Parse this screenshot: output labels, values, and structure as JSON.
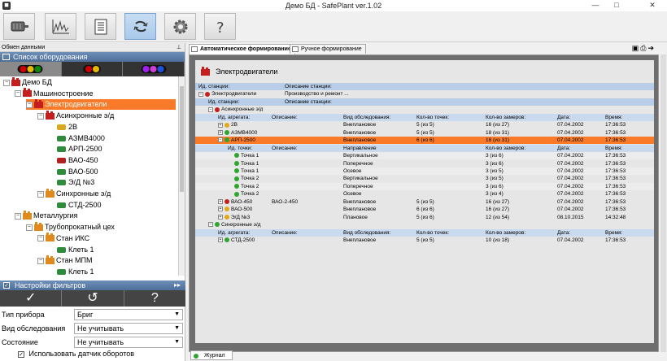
{
  "window": {
    "title": "Демо БД - SafePlant ver.1.02",
    "minimize": "—",
    "maximize": "□",
    "close": "✕"
  },
  "toolbar": {
    "buttons": [
      "motor",
      "spectrum",
      "report",
      "sync",
      "settings",
      "help"
    ]
  },
  "left": {
    "panel_title": "Обмен данными",
    "equipment_header": "Список оборудования",
    "filter_colors": [
      [
        "#d00000",
        "#e6b800",
        "#0a8a0a"
      ],
      [
        "#d00000",
        "#e6b800"
      ],
      [
        "#a020f0",
        "#d040d0",
        "#2050e0"
      ]
    ],
    "tree": [
      {
        "label": "Демо БД",
        "level": 0,
        "icon": "folder-red",
        "expand": "−"
      },
      {
        "label": "Машиностроение",
        "level": 1,
        "icon": "folder-red",
        "expand": "−"
      },
      {
        "label": "Электродвигатели",
        "level": 2,
        "icon": "folder-red",
        "expand": "−",
        "selected": true
      },
      {
        "label": "Асинхронные э/д",
        "level": 3,
        "icon": "folder-red",
        "expand": "−"
      },
      {
        "label": "2В",
        "level": 4,
        "icon": "motor-yellow"
      },
      {
        "label": "АЗМВ4000",
        "level": 4,
        "icon": "motor-green"
      },
      {
        "label": "АРП-2500",
        "level": 4,
        "icon": "motor-green"
      },
      {
        "label": "ВАО-450",
        "level": 4,
        "icon": "motor-red"
      },
      {
        "label": "ВАО-500",
        "level": 4,
        "icon": "motor-green"
      },
      {
        "label": "Э/Д №3",
        "level": 4,
        "icon": "motor-green"
      },
      {
        "label": "Синхронные э/д",
        "level": 3,
        "icon": "folder-orange",
        "expand": "−"
      },
      {
        "label": "СТД-2500",
        "level": 4,
        "icon": "motor-green"
      },
      {
        "label": "Металлургия",
        "level": 1,
        "icon": "folder-orange",
        "expand": "−"
      },
      {
        "label": "Трубопрокатный цех",
        "level": 2,
        "icon": "folder-orange",
        "expand": "−"
      },
      {
        "label": "Стан ИКС",
        "level": 3,
        "icon": "folder-orange",
        "expand": "−"
      },
      {
        "label": "Клеть 1",
        "level": 4,
        "icon": "motor-green"
      },
      {
        "label": "Стан МПМ",
        "level": 3,
        "icon": "folder-orange",
        "expand": "−"
      },
      {
        "label": "Клеть 1",
        "level": 4,
        "icon": "motor-green"
      }
    ],
    "filters_header": "Настройки фильтров",
    "action_labels": [
      "✓",
      "↺",
      "?"
    ],
    "filters": [
      {
        "label": "Тип прибора",
        "value": "Бриг"
      },
      {
        "label": "Вид обследования",
        "value": "Не учитывать"
      },
      {
        "label": "Состояние",
        "value": "Не учитывать"
      }
    ],
    "checkbox_label": "Использовать датчик оборотов",
    "checkbox_mark": "✓"
  },
  "tabs": [
    {
      "label": "Автоматическое формирование",
      "active": true
    },
    {
      "label": "Ручное формирование",
      "active": false
    }
  ],
  "doc_title": "Электродвигатели",
  "report_rows": [
    {
      "type": "hdr",
      "indent": 0,
      "cells": [
        "Ид. станции:",
        "Описание станции:"
      ]
    },
    {
      "type": "plain",
      "indent": 0,
      "pm": "−",
      "dot": "r",
      "cells": [
        "Электродвигатели",
        "Производство и ремонт ..."
      ]
    },
    {
      "type": "hdr",
      "indent": 1,
      "cells": [
        "Ид. станции:",
        "Описание станции:"
      ]
    },
    {
      "type": "plain",
      "indent": 1,
      "pm": "−",
      "dot": "r",
      "cells": [
        "Асинхронные э/д"
      ]
    },
    {
      "type": "hdr2",
      "indent": 2,
      "cells": [
        "Ид. агрегата:",
        "Описание:",
        "Вид обследования:",
        "Кол-во точек:",
        "Кол-во замеров:",
        "Дата:",
        "Время:"
      ]
    },
    {
      "type": "plain",
      "indent": 2,
      "pm": "+",
      "dot": "y",
      "cells": [
        "2В",
        "",
        "Внеплановое",
        "5  (из 5)",
        "16  (из 27)",
        "07.04.2002",
        "17:36:53"
      ]
    },
    {
      "type": "plain",
      "indent": 2,
      "pm": "+",
      "dot": "g",
      "cells": [
        "АЗМВ4000",
        "",
        "Внеплановое",
        "5  (из 5)",
        "18  (из 31)",
        "07.04.2002",
        "17:36:53"
      ]
    },
    {
      "type": "sel",
      "indent": 2,
      "pm": "−",
      "dot": "g",
      "cells": [
        "АРП-2500",
        "",
        "Внеплановое",
        "6  (из 6)",
        "18  (из 31)",
        "07.04.2002",
        "17:36:53"
      ]
    },
    {
      "type": "hdr2",
      "indent": 3,
      "cells": [
        "Ид. точки:",
        "Описание:",
        "Направление",
        "",
        "Кол-во замеров:",
        "Дата:",
        "Время:"
      ]
    },
    {
      "type": "alt",
      "indent": 3,
      "dot": "g",
      "cells": [
        "Точка 1",
        "",
        "Вертикальное",
        "",
        "3  (из 6)",
        "07.04.2002",
        "17:36:53"
      ]
    },
    {
      "type": "plain",
      "indent": 3,
      "dot": "g",
      "cells": [
        "Точка 1",
        "",
        "Поперечное",
        "",
        "3  (из 6)",
        "07.04.2002",
        "17:36:53"
      ]
    },
    {
      "type": "alt",
      "indent": 3,
      "dot": "g",
      "cells": [
        "Точка 1",
        "",
        "Осевое",
        "",
        "3  (из 5)",
        "07.04.2002",
        "17:36:53"
      ]
    },
    {
      "type": "plain",
      "indent": 3,
      "dot": "g",
      "cells": [
        "Точка 2",
        "",
        "Вертикальное",
        "",
        "3  (из 5)",
        "07.04.2002",
        "17:36:53"
      ]
    },
    {
      "type": "alt",
      "indent": 3,
      "dot": "g",
      "cells": [
        "Точка 2",
        "",
        "Поперечное",
        "",
        "3  (из 6)",
        "07.04.2002",
        "17:36:53"
      ]
    },
    {
      "type": "plain",
      "indent": 3,
      "dot": "g",
      "cells": [
        "Точка 2",
        "",
        "Осевое",
        "",
        "3  (из 4)",
        "07.04.2002",
        "17:36:53"
      ]
    },
    {
      "type": "plain",
      "indent": 2,
      "pm": "+",
      "dot": "r",
      "cells": [
        "ВАО-450",
        "ВАО-2-450",
        "Внеплановое",
        "5  (из 5)",
        "16  (из 27)",
        "07.04.2002",
        "17:36:53"
      ]
    },
    {
      "type": "plain",
      "indent": 2,
      "pm": "+",
      "dot": "y",
      "cells": [
        "ВАО-500",
        "",
        "Внеплановое",
        "6  (из 6)",
        "16  (из 27)",
        "07.04.2002",
        "17:36:53"
      ]
    },
    {
      "type": "plain",
      "indent": 2,
      "pm": "+",
      "dot": "y",
      "cells": [
        "Э/Д №3",
        "",
        "Плановое",
        "5  (из 6)",
        "12  (из 54)",
        "08.10.2015",
        "14:32:48"
      ]
    },
    {
      "type": "plain",
      "indent": 1,
      "pm": "−",
      "dot": "g",
      "cells": [
        "Синхронные э/д"
      ]
    },
    {
      "type": "hdr2",
      "indent": 2,
      "cells": [
        "Ид. агрегата:",
        "Описание:",
        "Вид обследования:",
        "Кол-во точек:",
        "Кол-во замеров:",
        "Дата:",
        "Время:"
      ]
    },
    {
      "type": "plain",
      "indent": 2,
      "pm": "+",
      "dot": "g",
      "cells": [
        "СТД-2500",
        "",
        "Внеплановое",
        "5  (из 5)",
        "10  (из 18)",
        "07.04.2002",
        "17:36:53"
      ]
    }
  ],
  "bottom_tab": "Журнал"
}
